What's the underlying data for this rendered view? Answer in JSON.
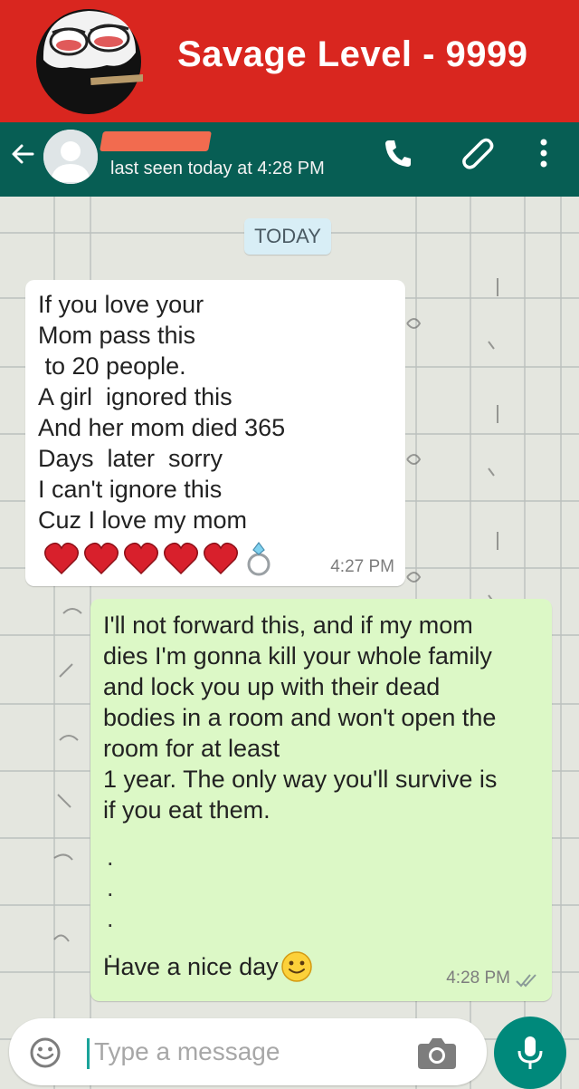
{
  "banner": {
    "title": "Savage Level - 9999"
  },
  "header": {
    "contact_name": "",
    "status": "last seen today at 4:28 PM",
    "colors": {
      "header_bg": "#075e54",
      "banner_bg": "#d9261f"
    }
  },
  "chat": {
    "date_chip": "TODAY",
    "messages": [
      {
        "direction": "incoming",
        "text": "If you love your\nMom pass this\n to 20 people.\nA girl  ignored this\nAnd her mom died 365\nDays  later  sorry\nI can't ignore this\nCuz I love my mom",
        "emojis": [
          "heart-icon",
          "heart-icon",
          "heart-icon",
          "heart-icon",
          "heart-icon",
          "ring-icon"
        ],
        "time": "4:27 PM"
      },
      {
        "direction": "outgoing",
        "text": "I'll not forward this, and if my mom\ndies I'm gonna kill your whole family\nand lock you up with their dead\nbodies in a room and won't open the\nroom for at least\n1 year. The only way you'll survive is\nif you eat them.",
        "dots": ".\n.\n.\n.",
        "closing": "Have a nice day",
        "closing_emoji": "smiley-icon",
        "time": "4:28 PM",
        "status": "read"
      }
    ]
  },
  "composer": {
    "placeholder": "Type a message",
    "value": ""
  }
}
